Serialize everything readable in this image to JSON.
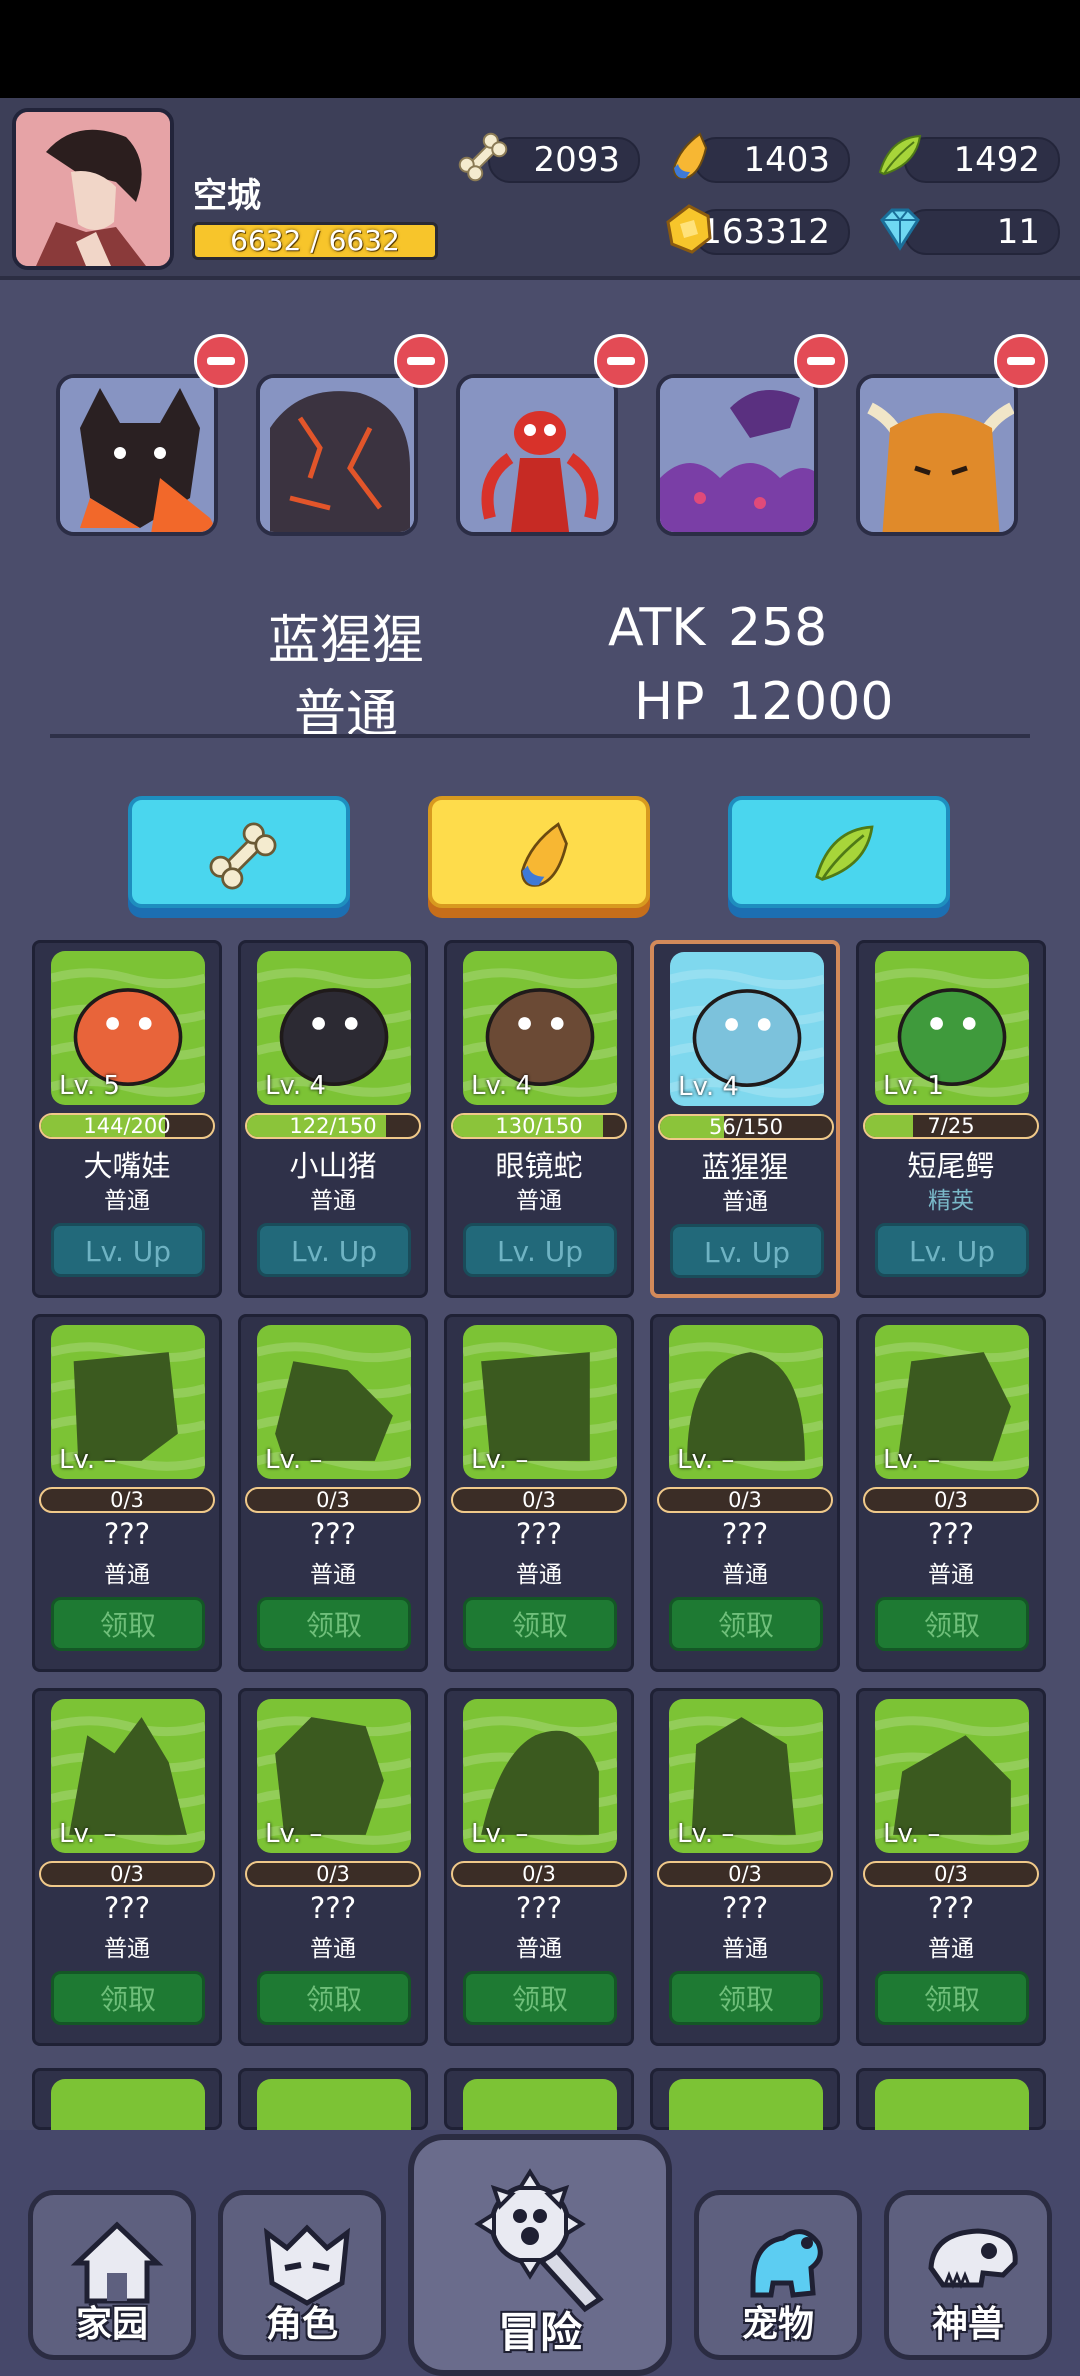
{
  "player": {
    "name": "空城",
    "hp_text": "6632 / 6632"
  },
  "resources": {
    "bone": "2093",
    "fang": "1403",
    "leaf": "1492",
    "gold": "163312",
    "diamond": "11"
  },
  "selected_pet": {
    "name": "蓝猩猩",
    "rarity": "普通",
    "atk_label": "ATK",
    "atk": "258",
    "hp_label": "HP",
    "hp": "12000"
  },
  "team": [
    {
      "name": "fire-fox"
    },
    {
      "name": "lava-golem"
    },
    {
      "name": "red-mantis"
    },
    {
      "name": "purple-scorpion"
    },
    {
      "name": "orange-bull"
    }
  ],
  "pets": [
    {
      "lv": "Lv. 5",
      "progress": "144/200",
      "ratio": 0.72,
      "name": "大嘴娃",
      "rarity": "普通",
      "button": "Lv. Up",
      "unlocked": true,
      "elite": false,
      "selected": false,
      "color": "#e8643a"
    },
    {
      "lv": "Lv. 4",
      "progress": "122/150",
      "ratio": 0.81,
      "name": "小山猪",
      "rarity": "普通",
      "button": "Lv. Up",
      "unlocked": true,
      "elite": false,
      "selected": false,
      "color": "#2c2a33"
    },
    {
      "lv": "Lv. 4",
      "progress": "130/150",
      "ratio": 0.87,
      "name": "眼镜蛇",
      "rarity": "普通",
      "button": "Lv. Up",
      "unlocked": true,
      "elite": false,
      "selected": false,
      "color": "#6b4a35"
    },
    {
      "lv": "Lv. 4",
      "progress": "56/150",
      "ratio": 0.37,
      "name": "蓝猩猩",
      "rarity": "普通",
      "button": "Lv. Up",
      "unlocked": true,
      "elite": false,
      "selected": true,
      "color": "#7cc2dc"
    },
    {
      "lv": "Lv. 1",
      "progress": "7/25",
      "ratio": 0.28,
      "name": "短尾鳄",
      "rarity": "精英",
      "button": "Lv. Up",
      "unlocked": true,
      "elite": true,
      "selected": false,
      "color": "#3f9a3c"
    },
    {
      "lv": "Lv. –",
      "progress": "0/3",
      "ratio": 0,
      "name": "???",
      "rarity": "普通",
      "button": "领取",
      "unlocked": false
    },
    {
      "lv": "Lv. –",
      "progress": "0/3",
      "ratio": 0,
      "name": "???",
      "rarity": "普通",
      "button": "领取",
      "unlocked": false
    },
    {
      "lv": "Lv. –",
      "progress": "0/3",
      "ratio": 0,
      "name": "???",
      "rarity": "普通",
      "button": "领取",
      "unlocked": false
    },
    {
      "lv": "Lv. –",
      "progress": "0/3",
      "ratio": 0,
      "name": "???",
      "rarity": "普通",
      "button": "领取",
      "unlocked": false
    },
    {
      "lv": "Lv. –",
      "progress": "0/3",
      "ratio": 0,
      "name": "???",
      "rarity": "普通",
      "button": "领取",
      "unlocked": false
    },
    {
      "lv": "Lv. –",
      "progress": "0/3",
      "ratio": 0,
      "name": "???",
      "rarity": "普通",
      "button": "领取",
      "unlocked": false
    },
    {
      "lv": "Lv. –",
      "progress": "0/3",
      "ratio": 0,
      "name": "???",
      "rarity": "普通",
      "button": "领取",
      "unlocked": false
    },
    {
      "lv": "Lv. –",
      "progress": "0/3",
      "ratio": 0,
      "name": "???",
      "rarity": "普通",
      "button": "领取",
      "unlocked": false
    },
    {
      "lv": "Lv. –",
      "progress": "0/3",
      "ratio": 0,
      "name": "???",
      "rarity": "普通",
      "button": "领取",
      "unlocked": false
    },
    {
      "lv": "Lv. –",
      "progress": "0/3",
      "ratio": 0,
      "name": "???",
      "rarity": "普通",
      "button": "领取",
      "unlocked": false
    }
  ],
  "nav": {
    "home": "家园",
    "role": "角色",
    "adventure": "冒险",
    "pet": "宠物",
    "beast": "神兽"
  }
}
